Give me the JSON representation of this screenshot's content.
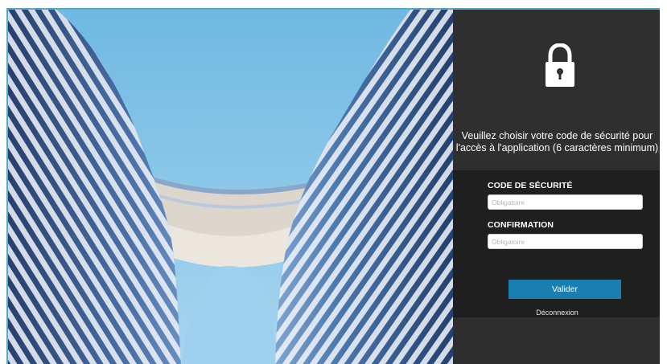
{
  "panel": {
    "lock_icon": "padlock-icon",
    "instructions": "Veuillez choisir votre code de sécurité pour l'accès à l'application (6 caractères minimum)"
  },
  "form": {
    "security_code_label": "CODE DE SÉCURITÉ",
    "security_code_placeholder": "Obligatoire",
    "security_code_value": "",
    "confirmation_label": "CONFIRMATION",
    "confirmation_placeholder": "Obligatoire",
    "confirmation_value": "",
    "submit_label": "Valider",
    "logout_label": "Déconnexion"
  },
  "colors": {
    "accent": "#1a7fb0",
    "panel_bg": "#2e2e2e",
    "form_bg": "#1f1f1f",
    "sky": "#8ccbea",
    "border": "#5aa8c8"
  }
}
